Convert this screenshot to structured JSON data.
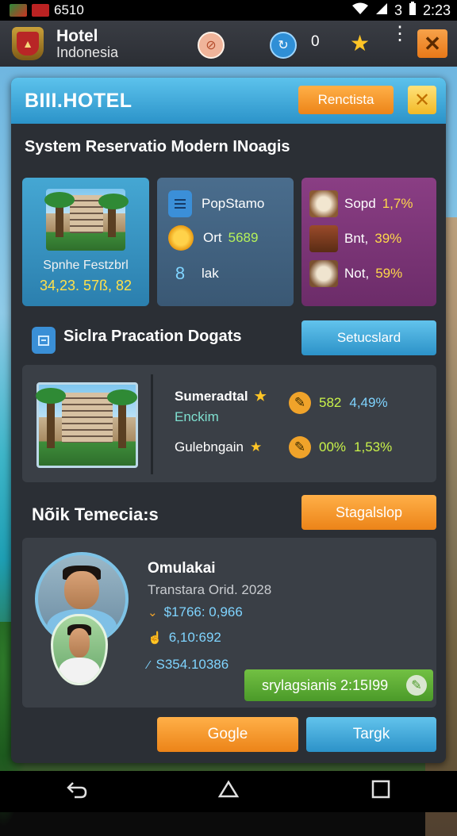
{
  "status_bar": {
    "left_text": "6510",
    "signal_text": "3",
    "time": "2:23"
  },
  "app_header": {
    "title": "Hotel",
    "subtitle": "Indonesia",
    "counter": "0",
    "icons": [
      "compass-icon",
      "refresh-icon",
      "star-icon",
      "more-vert-icon",
      "close-icon"
    ]
  },
  "panel": {
    "title": "BIII.HOTEL",
    "register_button": "Renctista",
    "subtitle": "System Reservatio Modern INoagis"
  },
  "card_hotel": {
    "caption": "Spnhe Festzbrl",
    "value": "34,23. 57ß, 82"
  },
  "card_stats": {
    "rows": [
      {
        "label": "PopStamo",
        "value": ""
      },
      {
        "label": "Ort",
        "value": "5689"
      },
      {
        "label": "lak",
        "value": ""
      }
    ]
  },
  "card_food": {
    "rows": [
      {
        "label": "Sopd",
        "value": "1,7%"
      },
      {
        "label": "Bnt,",
        "value": "39%"
      },
      {
        "label": "Not,",
        "value": "59%"
      }
    ]
  },
  "section2": {
    "title": "Siclra Pracation Dogats",
    "button": "Setucslard",
    "line1_label": "Sumeradtal",
    "line1_sub": "Enckim",
    "line1_v1": "582",
    "line1_v2": "4,49%",
    "line2_label": "Gulebngain",
    "line2_v1": "00%",
    "line2_v2": "1,53%"
  },
  "section3": {
    "title": "Nõik Temecia:s",
    "button": "Stagalslop",
    "name": "Omulakai",
    "meta": "Transtara Orid. 2028",
    "stat1": "$1766: 0,966",
    "stat2": "6,10:692",
    "stat3": "S354.10386",
    "pill": "srylagsianis 2:15I99"
  },
  "footer_buttons": {
    "left": "Gogle",
    "right": "Targk"
  },
  "colors": {
    "accent_blue": "#3aa6dc",
    "accent_orange": "#f08c22",
    "accent_green": "#5aac33",
    "panel_bg": "#2b2f35"
  }
}
